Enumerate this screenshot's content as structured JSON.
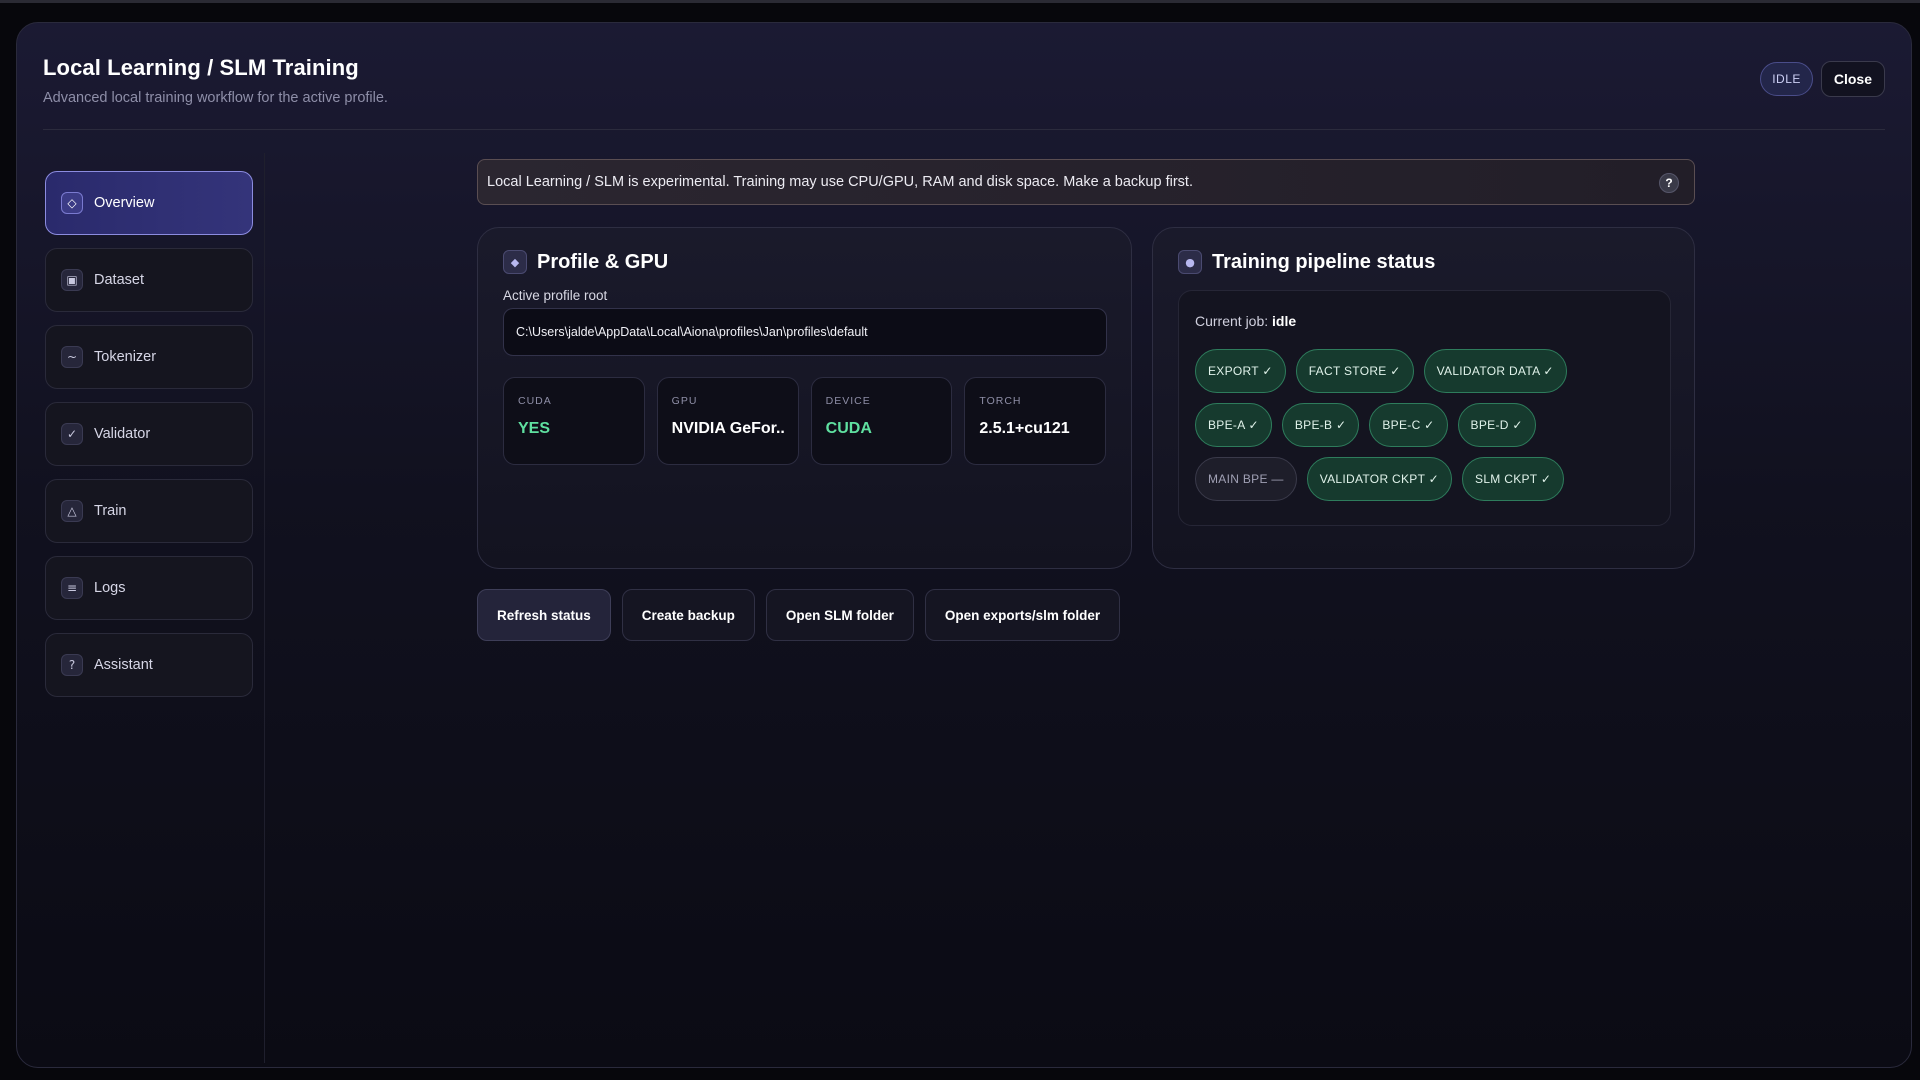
{
  "header": {
    "title": "Local Learning / SLM Training",
    "subtitle": "Advanced local training workflow for the active profile.",
    "status_badge": "IDLE",
    "close_label": "Close"
  },
  "sidebar": {
    "items": [
      {
        "label": "Overview",
        "icon": "◇",
        "active": true
      },
      {
        "label": "Dataset",
        "icon": "▣"
      },
      {
        "label": "Tokenizer",
        "icon": "~"
      },
      {
        "label": "Validator",
        "icon": "✓"
      },
      {
        "label": "Train",
        "icon": "△"
      },
      {
        "label": "Logs",
        "icon": "≡"
      },
      {
        "label": "Assistant",
        "icon": "?"
      }
    ]
  },
  "alert": {
    "text": "Local Learning / SLM is experimental. Training may use CPU/GPU, RAM and disk space. Make a backup first.",
    "help": "?"
  },
  "profile_card": {
    "title": "Profile & GPU",
    "icon": "◆",
    "field_label": "Active profile root",
    "path": "C:\\Users\\jalde\\AppData\\Local\\Aiona\\profiles\\Jan\\profiles\\default",
    "stats": [
      {
        "label": "CUDA",
        "value": "YES"
      },
      {
        "label": "GPU",
        "value": "NVIDIA GeFor..."
      },
      {
        "label": "DEVICE",
        "value": "CUDA"
      },
      {
        "label": "TORCH",
        "value": "2.5.1+cu121"
      }
    ]
  },
  "pipeline_card": {
    "title": "Training pipeline status",
    "icon": "●",
    "current_job_label": "Current job:",
    "current_job_value": "idle",
    "chips": [
      "EXPORT ✓",
      "FACT STORE ✓",
      "VALIDATOR DATA ✓",
      "BPE-A ✓",
      "BPE-B ✓",
      "BPE-C ✓",
      "BPE-D ✓",
      "MAIN BPE —",
      "VALIDATOR CKPT ✓",
      "SLM CKPT ✓"
    ]
  },
  "actions": {
    "refresh": "Refresh status",
    "backup": "Create backup",
    "open_slm": "Open SLM folder",
    "open_exports": "Open exports/slm folder"
  }
}
